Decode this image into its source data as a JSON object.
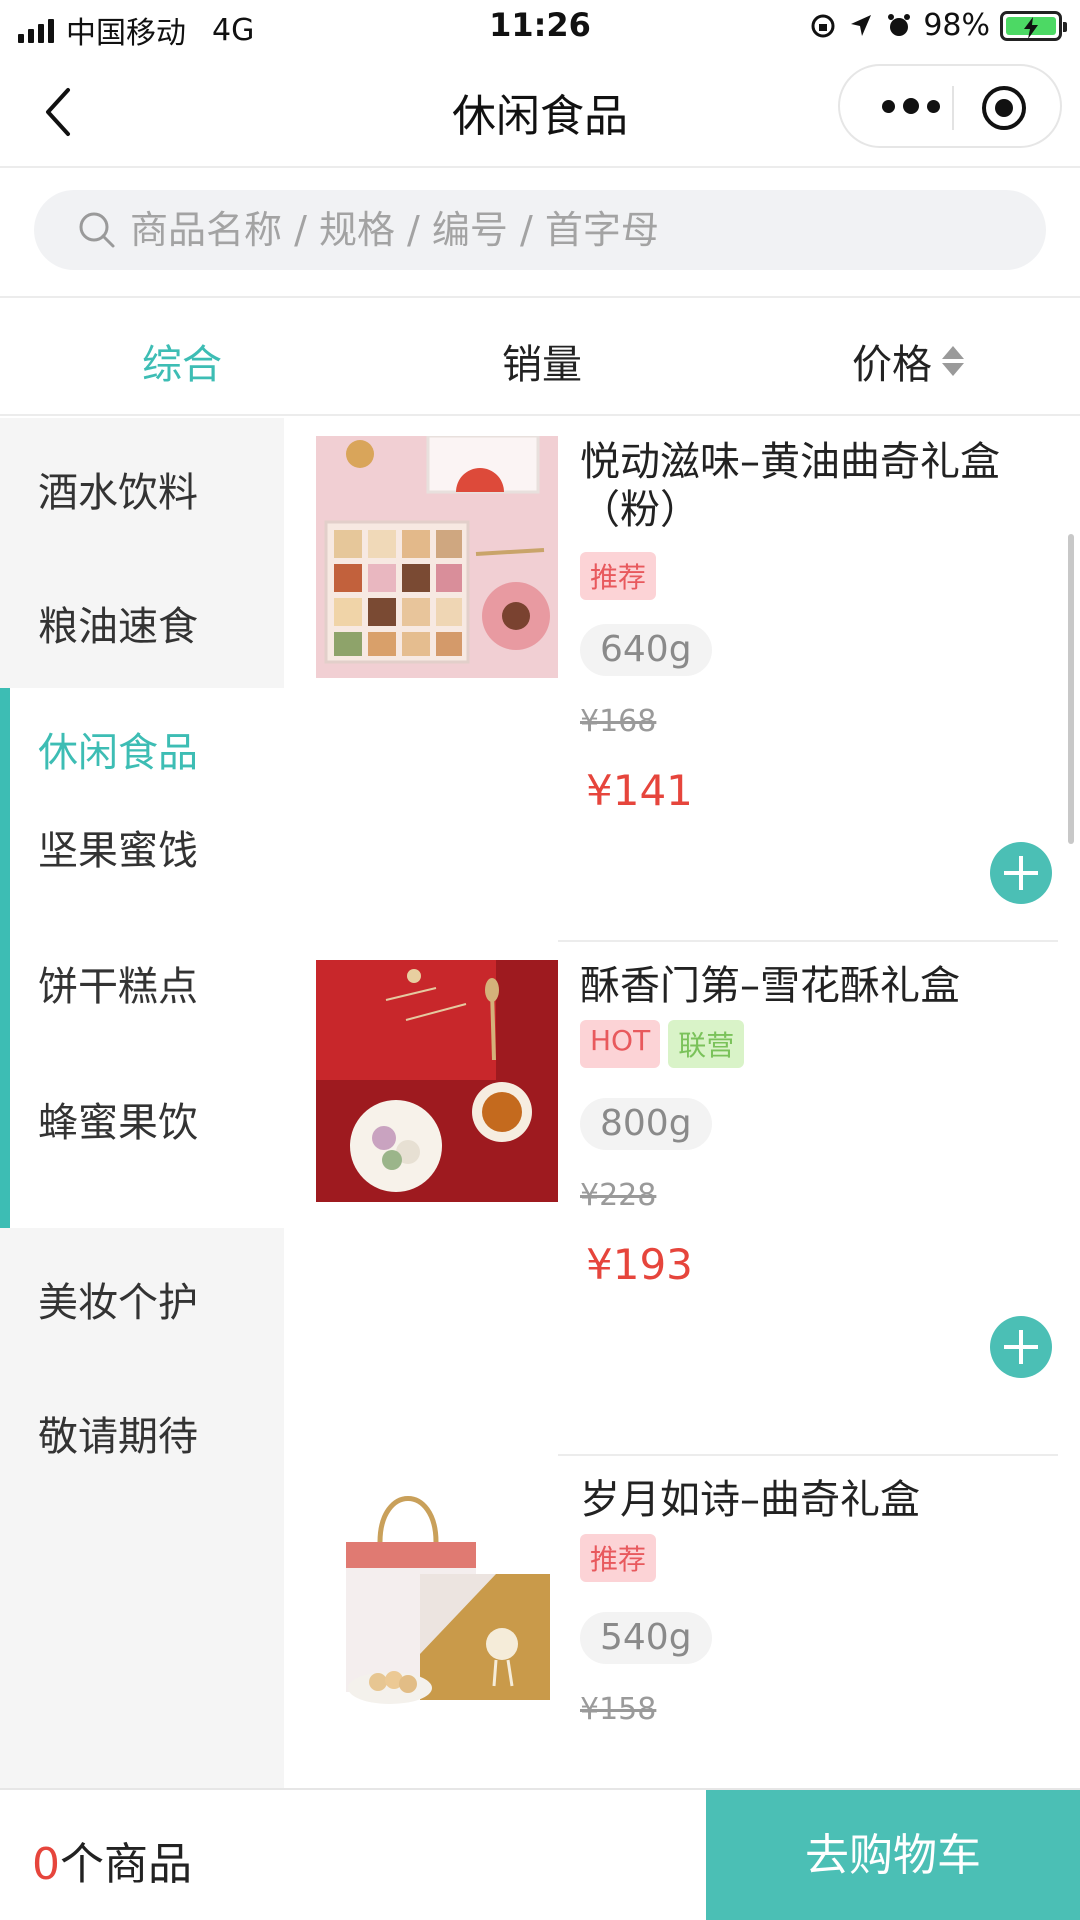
{
  "status_bar": {
    "carrier": "中国移动",
    "network": "4G",
    "time": "11:26",
    "battery": "98%"
  },
  "nav": {
    "title": "休闲食品"
  },
  "search": {
    "placeholder": "商品名称 / 规格 / 编号 / 首字母"
  },
  "sort_tabs": [
    {
      "label": "综合",
      "active": true
    },
    {
      "label": "销量",
      "active": false
    },
    {
      "label": "价格",
      "active": false
    }
  ],
  "sidebar": {
    "items": [
      {
        "label": "酒水饮料"
      },
      {
        "label": "粮油速食"
      },
      {
        "label": "休闲食品",
        "active": true
      },
      {
        "label": "坚果蜜饯"
      },
      {
        "label": "饼干糕点"
      },
      {
        "label": "蜂蜜果饮"
      },
      {
        "label": "美妆个护"
      },
      {
        "label": "敬请期待"
      }
    ]
  },
  "products": [
    {
      "name": "悦动滋味–黄油曲奇礼盒（粉）",
      "tags": [
        "推荐"
      ],
      "spec": "640g",
      "original_price": "¥168",
      "price": "¥141"
    },
    {
      "name": "酥香门第–雪花酥礼盒",
      "tags": [
        "HOT",
        "联营"
      ],
      "spec": "800g",
      "original_price": "¥228",
      "price": "¥193"
    },
    {
      "name": "岁月如诗–曲奇礼盒",
      "tags": [
        "推荐"
      ],
      "spec": "540g",
      "original_price": "¥158"
    }
  ],
  "bottom_bar": {
    "cart_count": "0",
    "cart_suffix": "个商品",
    "checkout_label": "去购物车"
  },
  "colors": {
    "accent": "#3dbdb4",
    "price": "#e6453c",
    "button": "#4bbfb5"
  }
}
